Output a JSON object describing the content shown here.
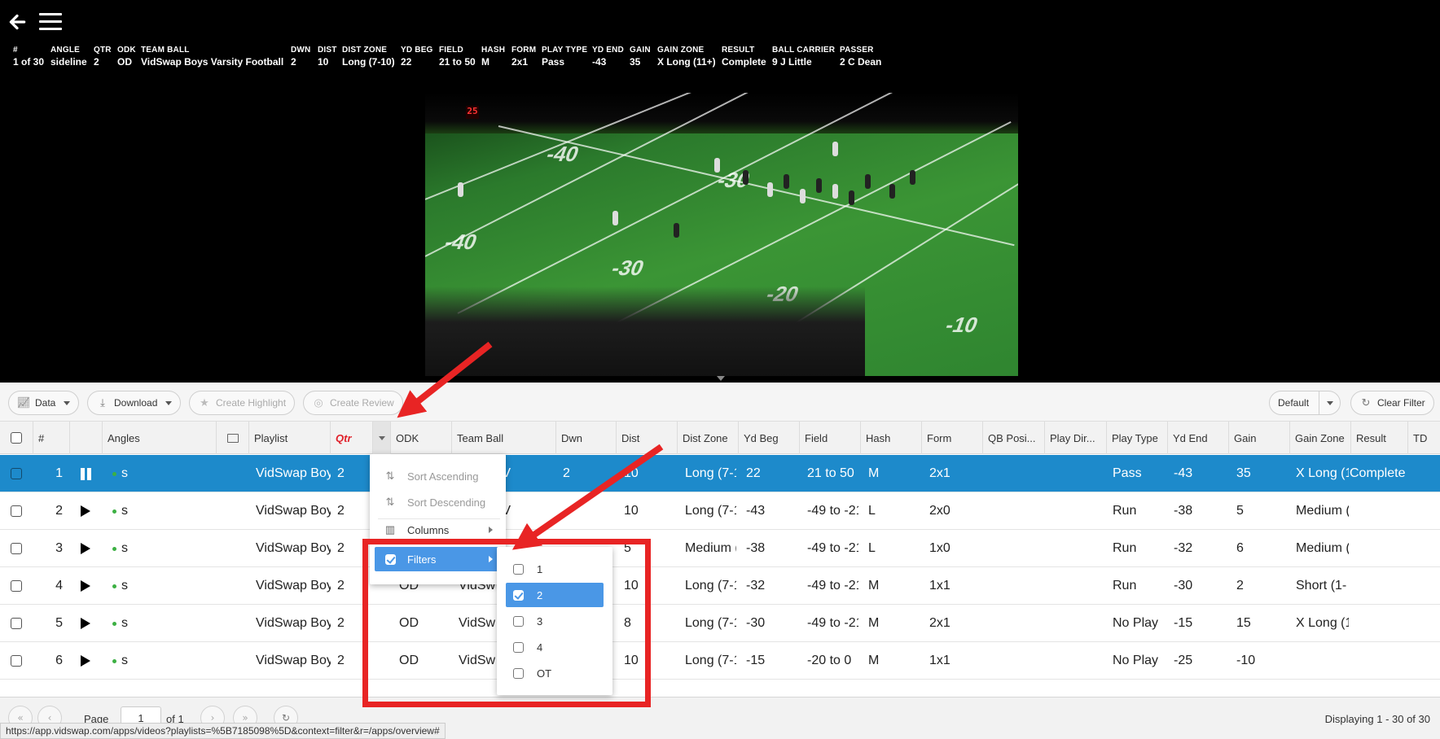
{
  "video": {
    "overlay": [
      {
        "header": "#",
        "value": "1 of 30"
      },
      {
        "header": "ANGLE",
        "value": "sideline"
      },
      {
        "header": "QTR",
        "value": "2"
      },
      {
        "header": "ODK",
        "value": "OD"
      },
      {
        "header": "TEAM BALL",
        "value": "VidSwap Boys Varsity Football"
      },
      {
        "header": "DWN",
        "value": "2"
      },
      {
        "header": "DIST",
        "value": "10"
      },
      {
        "header": "DIST ZONE",
        "value": "Long (7-10)"
      },
      {
        "header": "YD BEG",
        "value": "22"
      },
      {
        "header": "FIELD",
        "value": "21 to 50"
      },
      {
        "header": "HASH",
        "value": "M"
      },
      {
        "header": "FORM",
        "value": "2x1"
      },
      {
        "header": "PLAY TYPE",
        "value": "Pass"
      },
      {
        "header": "YD END",
        "value": "-43"
      },
      {
        "header": "GAIN",
        "value": "35"
      },
      {
        "header": "GAIN ZONE",
        "value": "X Long (11+)"
      },
      {
        "header": "RESULT",
        "value": "Complete"
      },
      {
        "header": "BALL CARRIER",
        "value": "9 J Little"
      },
      {
        "header": "PASSER",
        "value": "2 C Dean"
      }
    ],
    "scoreboard": "25",
    "yard_numbers": [
      "-40",
      "-30",
      "-20",
      "-10",
      "-30",
      "-40"
    ]
  },
  "toolbar": {
    "data_label": "Data",
    "download_label": "Download",
    "create_highlight_label": "Create Highlight",
    "create_review_label": "Create Review",
    "default_label": "Default",
    "clear_filter_label": "Clear Filter"
  },
  "columns": [
    "#",
    "Angles",
    "Playlist",
    "Qtr",
    "ODK",
    "Team Ball",
    "Dwn",
    "Dist",
    "Dist Zone",
    "Yd Beg",
    "Field",
    "Hash",
    "Form",
    "QB Posi...",
    "Play Dir...",
    "Play Type",
    "Yd End",
    "Gain",
    "Gain Zone",
    "Result",
    "TD"
  ],
  "rows": [
    {
      "num": "1",
      "angle": "s",
      "playlist": "VidSwap Boy",
      "qtr": "2",
      "odk": "",
      "team": "p Boys V",
      "dwn": "2",
      "dist": "10",
      "dist_zone": "Long (7-1",
      "yd_beg": "22",
      "field": "21 to 50",
      "hash": "M",
      "form": "2x1",
      "play_type": "Pass",
      "yd_end": "-43",
      "gain": "35",
      "gain_zone": "X Long (1",
      "result": "Complete"
    },
    {
      "num": "2",
      "angle": "s",
      "playlist": "VidSwap Boy",
      "qtr": "2",
      "odk": "",
      "team": "p Boys V",
      "dwn": "",
      "dist": "10",
      "dist_zone": "Long (7-1",
      "yd_beg": "-43",
      "field": "-49 to -21",
      "hash": "L",
      "form": "2x0",
      "play_type": "Run",
      "yd_end": "-38",
      "gain": "5",
      "gain_zone": "Medium (",
      "result": ""
    },
    {
      "num": "3",
      "angle": "s",
      "playlist": "VidSwap Boy",
      "qtr": "2",
      "odk": "",
      "team": "",
      "dwn": "",
      "dist": "5",
      "dist_zone": "Medium (",
      "yd_beg": "-38",
      "field": "-49 to -21",
      "hash": "L",
      "form": "1x0",
      "play_type": "Run",
      "yd_end": "-32",
      "gain": "6",
      "gain_zone": "Medium (",
      "result": ""
    },
    {
      "num": "4",
      "angle": "s",
      "playlist": "VidSwap Boy",
      "qtr": "2",
      "odk": "OD",
      "team": "VidSw",
      "dwn": "",
      "dist": "10",
      "dist_zone": "Long (7-1",
      "yd_beg": "-32",
      "field": "-49 to -21",
      "hash": "M",
      "form": "1x1",
      "play_type": "Run",
      "yd_end": "-30",
      "gain": "2",
      "gain_zone": "Short (1-",
      "result": ""
    },
    {
      "num": "5",
      "angle": "s",
      "playlist": "VidSwap Boy",
      "qtr": "2",
      "odk": "OD",
      "team": "VidSw",
      "dwn": "",
      "dist": "8",
      "dist_zone": "Long (7-1",
      "yd_beg": "-30",
      "field": "-49 to -21",
      "hash": "M",
      "form": "2x1",
      "play_type": "No Play",
      "yd_end": "-15",
      "gain": "15",
      "gain_zone": "X Long (1",
      "result": ""
    },
    {
      "num": "6",
      "angle": "s",
      "playlist": "VidSwap Boy",
      "qtr": "2",
      "odk": "OD",
      "team": "VidSw",
      "dwn": "",
      "dist": "10",
      "dist_zone": "Long (7-1",
      "yd_beg": "-15",
      "field": "-20 to 0",
      "hash": "M",
      "form": "1x1",
      "play_type": "No Play",
      "yd_end": "-25",
      "gain": "-10",
      "gain_zone": "",
      "result": ""
    }
  ],
  "column_menu": {
    "sort_asc": "Sort Ascending",
    "sort_desc": "Sort Descending",
    "columns": "Columns",
    "filters": "Filters"
  },
  "filter_options": [
    {
      "label": "1",
      "checked": false
    },
    {
      "label": "2",
      "checked": true
    },
    {
      "label": "3",
      "checked": false
    },
    {
      "label": "4",
      "checked": false
    },
    {
      "label": "OT",
      "checked": false
    }
  ],
  "pager": {
    "page_label": "Page",
    "page_value": "1",
    "of_label": "of 1",
    "displaying": "Displaying 1 - 30 of 30"
  },
  "status_url": "https://app.vidswap.com/apps/videos?playlists=%5B7185098%5D&context=filter&r=/apps/overview#",
  "colors": {
    "selected_row": "#1d8acb",
    "menu_highlight": "#4a97e6",
    "annotation": "#e82424",
    "sorted_header": "#e0202a"
  }
}
